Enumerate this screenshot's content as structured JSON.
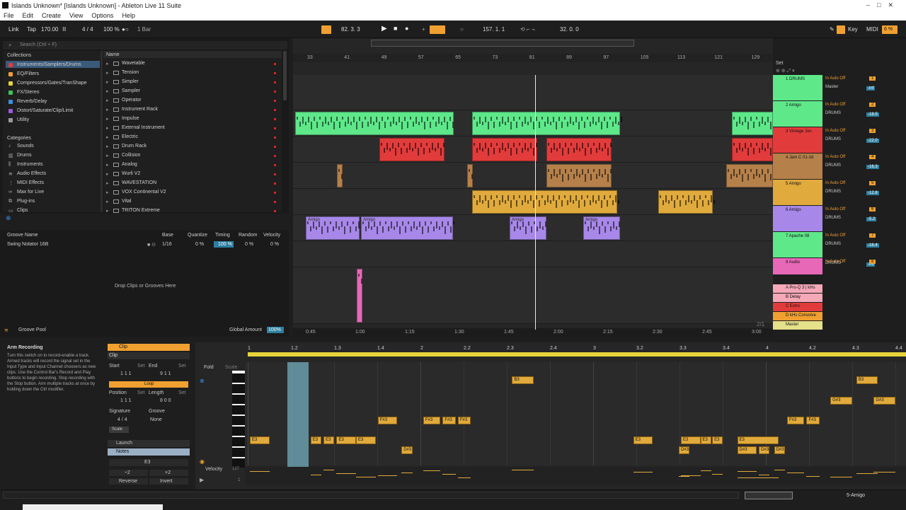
{
  "window": {
    "title": "Islands Unknown* [Islands Unknown] - Ableton Live 11 Suite"
  },
  "menu": [
    "File",
    "Edit",
    "Create",
    "View",
    "Options",
    "Help"
  ],
  "transport": {
    "link": "Link",
    "tap": "Tap",
    "tempo": "170.00",
    "signature": "4 / 4",
    "zoom": "100 %",
    "quantize": "1 Bar",
    "arrangement_pos": "82. 3. 3",
    "loop_start": "157. 1. 1",
    "loop_length": "32. 0. 0",
    "key": "Key",
    "midi": "MIDI",
    "cpu": "6 %"
  },
  "browser": {
    "search_placeholder": "Search (Ctrl + F)",
    "collections_header": "Collections",
    "collections": [
      {
        "label": "Instruments/Samplers/Drums",
        "color": "#e23b3b"
      },
      {
        "label": "EQ/Filters",
        "color": "#f0a030"
      },
      {
        "label": "Compressors/Gates/TranShape",
        "color": "#e5d43c"
      },
      {
        "label": "FX/Stereo",
        "color": "#3ec45a"
      },
      {
        "label": "Reverb/Delay",
        "color": "#3a8fe0"
      },
      {
        "label": "Distort/Saturate/Clip/Limit",
        "color": "#9a5ae0"
      },
      {
        "label": "Utility",
        "color": "#9a9a9a"
      }
    ],
    "categories_header": "Categories",
    "categories": [
      "Sounds",
      "Drums",
      "Instruments",
      "Audio Effects",
      "MIDI Effects",
      "Max for Live",
      "Plug-ins",
      "Clips"
    ],
    "name_header": "Name",
    "items": [
      "Wavetable",
      "Tension",
      "Simpler",
      "Sampler",
      "Operator",
      "Instrument Rack",
      "Impulse",
      "External Instrument",
      "Electric",
      "Drum Rack",
      "Collision",
      "Analog",
      "Wurli V2",
      "WAVESTATION",
      "VOX Continental V2",
      "Vital",
      "TRITON Extreme"
    ]
  },
  "groove": {
    "headers": [
      "Groove Name",
      "Base",
      "Quantize",
      "Timing",
      "Random",
      "Velocity"
    ],
    "row": {
      "name": "Swing Notator 16B",
      "base": "1/16",
      "quantize": "0 %",
      "timing": "100 %",
      "random": "0 %",
      "velocity": "0 %"
    },
    "drop": "Drop Clips or Grooves Here",
    "pool": "Groove Pool",
    "global_label": "Global Amount",
    "global_value": "100%"
  },
  "arrangement": {
    "bars": [
      "33",
      "41",
      "49",
      "57",
      "65",
      "73",
      "81",
      "89",
      "97",
      "105",
      "113",
      "121",
      "129"
    ],
    "times": [
      "0:45",
      "1:00",
      "1:15",
      "1:30",
      "1:45",
      "2:00",
      "2:15",
      "2:30",
      "2:45",
      "3:00"
    ],
    "set": "Set",
    "clip_name": "Amigo",
    "page": "2/1"
  },
  "tracks": [
    {
      "num": "1",
      "name": "DRUMS",
      "color": "#5ee88a",
      "input": "Master",
      "vol": "-inf"
    },
    {
      "num": "2",
      "name": "Amigo",
      "color": "#5ee88a",
      "input": "DRUMS",
      "vol": "-18.5"
    },
    {
      "num": "3",
      "name": "Vintage Jun",
      "color": "#e23b3b",
      "input": "DRUMS",
      "vol": "-22.0"
    },
    {
      "num": "4",
      "name": "Jam C 01-16",
      "color": "#b5804a",
      "input": "DRUMS",
      "vol": "-16.3"
    },
    {
      "num": "5",
      "name": "Amigo",
      "color": "#e0aa3c",
      "input": "DRUMS",
      "vol": "-12.8"
    },
    {
      "num": "6",
      "name": "Amigo",
      "color": "#a788e8",
      "input": "DRUMS",
      "vol": "-5.2"
    },
    {
      "num": "7",
      "name": "Apache 08",
      "color": "#5ee88a",
      "input": "DRUMS",
      "vol": "-16.4"
    },
    {
      "num": "8",
      "name": "Audio",
      "color": "#e868b8",
      "input": "DRUMS",
      "vol": "-inf"
    }
  ],
  "returns": [
    {
      "name": "A Pro-Q 3 | kHs",
      "color": "#f4a8b8"
    },
    {
      "name": "B Delay",
      "color": "#f4a8b8"
    },
    {
      "name": "C Echo",
      "color": "#e23b3b"
    },
    {
      "name": "D kHs Convolve",
      "color": "#f0a030"
    },
    {
      "name": "Master",
      "color": "#e5e08a"
    }
  ],
  "info": {
    "title": "Arm Recording",
    "text": "Turn this switch on to record-enable a track. Armed tracks will record the signal set in the Input Type and Input Channel choosers as new clips. Use the Control Bar's Record and Play buttons to begin recording. Stop recording with the Stop button. Arm multiple tracks at once by holding down the Ctrl modifier."
  },
  "clip": {
    "title": "Clip",
    "start": "Start",
    "end": "End",
    "set": "Set",
    "start_val": "1 1 1",
    "end_val": "9 1 1",
    "loop": "Loop",
    "position": "Position",
    "length": "Length",
    "pos_val": "1 1 1",
    "len_val": "8 0 0",
    "signature": "Signature",
    "groove": "Groove",
    "sig_val": "4 / 4",
    "groove_val": "None",
    "scale": "Scale",
    "launch": "Launch",
    "notes": "Notes",
    "note_val": "E3",
    "halve": "÷2",
    "double": "×2",
    "reverse": "Reverse",
    "invert": "Invert"
  },
  "editor": {
    "fold": "Fold",
    "scale": "Scale",
    "velocity": "Velocity",
    "vel_max": "127",
    "vel_min": "1",
    "ruler": [
      "1",
      "1.2",
      "1.3",
      "1.4",
      "2",
      "2.2",
      "2.3",
      "2.4",
      "3",
      "3.2",
      "3.3",
      "3.4",
      "4",
      "4.2",
      "4.3",
      "4.4"
    ],
    "notes": [
      {
        "label": "B3",
        "bar": 7.1,
        "len": 0.5,
        "row": 0
      },
      {
        "label": "B3",
        "bar": 15.05,
        "len": 0.5,
        "row": 0
      },
      {
        "label": "G#3",
        "bar": 14.45,
        "len": 0.5,
        "row": 1
      },
      {
        "label": "G#3",
        "bar": 15.45,
        "len": 0.5,
        "row": 1
      },
      {
        "label": "F#3",
        "bar": 4.0,
        "len": 0.45,
        "row": 2
      },
      {
        "label": "F#3",
        "bar": 5.05,
        "len": 0.4,
        "row": 2
      },
      {
        "label": "F#3",
        "bar": 5.5,
        "len": 0.3,
        "row": 2
      },
      {
        "label": "F#3",
        "bar": 5.85,
        "len": 0.3,
        "row": 2
      },
      {
        "label": "F#3",
        "bar": 13.45,
        "len": 0.4,
        "row": 2
      },
      {
        "label": "F#3",
        "bar": 13.9,
        "len": 0.3,
        "row": 2
      },
      {
        "label": "E3",
        "bar": 1.05,
        "len": 0.45,
        "row": 3
      },
      {
        "label": "E3",
        "bar": 2.45,
        "len": 0.25,
        "row": 3
      },
      {
        "label": "E3",
        "bar": 2.75,
        "len": 0.25,
        "row": 3
      },
      {
        "label": "E3",
        "bar": 3.05,
        "len": 0.45,
        "row": 3
      },
      {
        "label": "E3",
        "bar": 3.5,
        "len": 0.45,
        "row": 3
      },
      {
        "label": "E3",
        "bar": 9.9,
        "len": 0.45,
        "row": 3
      },
      {
        "label": "E3",
        "bar": 11.0,
        "len": 0.45,
        "row": 3
      },
      {
        "label": "E3",
        "bar": 11.45,
        "len": 0.25,
        "row": 3
      },
      {
        "label": "E3",
        "bar": 11.72,
        "len": 0.25,
        "row": 3
      },
      {
        "label": "E3",
        "bar": 12.3,
        "len": 0.95,
        "row": 3
      },
      {
        "label": "D#3",
        "bar": 4.55,
        "len": 0.25,
        "row": 4
      },
      {
        "label": "D#3",
        "bar": 10.95,
        "len": 0.25,
        "row": 4
      },
      {
        "label": "D#3",
        "bar": 12.3,
        "len": 0.45,
        "row": 4
      },
      {
        "label": "D#3",
        "bar": 12.8,
        "len": 0.25,
        "row": 4
      },
      {
        "label": "D#3",
        "bar": 13.15,
        "len": 0.25,
        "row": 4
      }
    ]
  },
  "status": {
    "track": "5-Amigo"
  }
}
